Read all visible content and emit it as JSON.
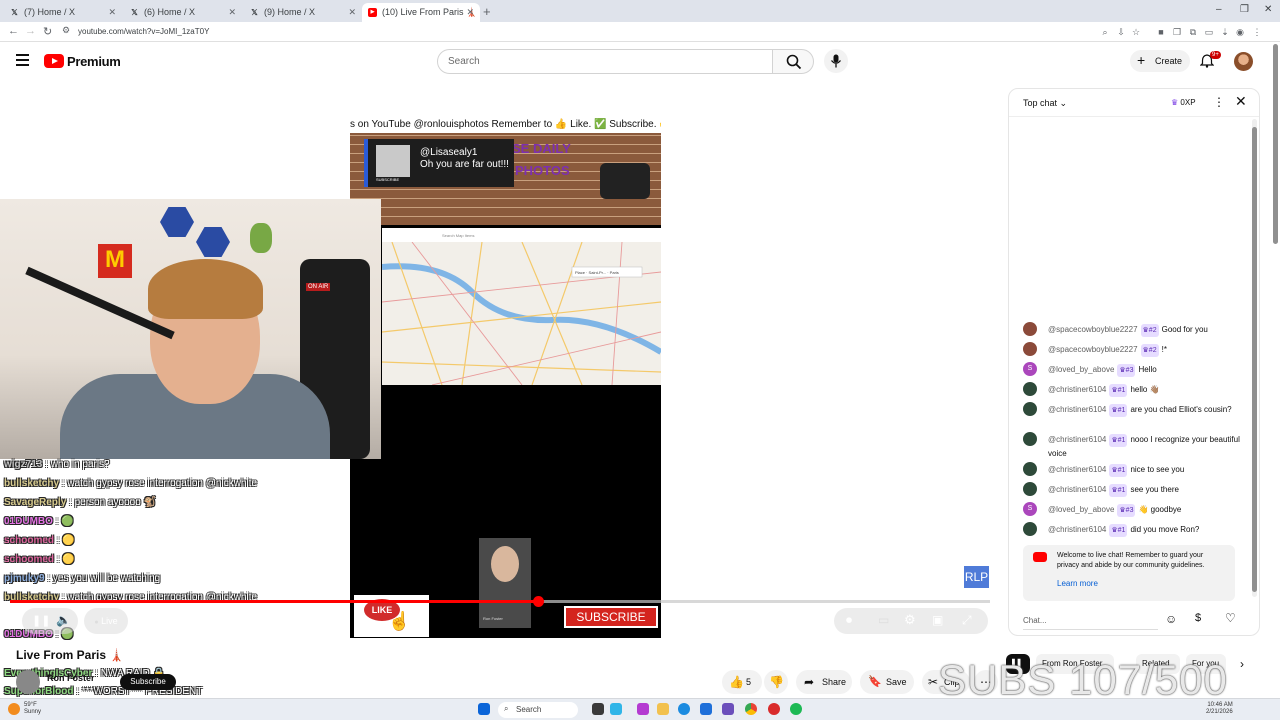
{
  "browser": {
    "tabs": [
      {
        "label": "(7) Home / X",
        "icon": "x-logo-icon",
        "active": false
      },
      {
        "label": "(6) Home / X",
        "icon": "x-logo-icon",
        "active": false
      },
      {
        "label": "(9) Home / X",
        "icon": "x-logo-icon",
        "active": false
      },
      {
        "label": "(10) Live From Paris 🗼 - Yo",
        "icon": "youtube-icon",
        "active": true
      }
    ],
    "new_tab": "+",
    "url": "youtube.com/watch?v=JoMI_1zaT0Y",
    "window_controls": {
      "minimize": "–",
      "restore": "❐",
      "close": "✕"
    }
  },
  "header": {
    "logo_text": "Premium",
    "search_placeholder": "Search",
    "create_label": "Create",
    "notifications_badge": "9+"
  },
  "video": {
    "ticker_text": "s on YouTube @ronlouisphotos Remember to 👍 Like. ✅ Subscribe. 👉Sh",
    "brick_title": "SE DAILY",
    "brick_subtitle": "PHOTOS",
    "popup_name": "@Lisasealy1",
    "popup_message": "Oh you are far out!!!",
    "popup_tag": "SUBSCRIBE",
    "map_search": "Search Map Items",
    "map_places": "Place · Saint-Pr... · Paris",
    "like_text": "LIKE",
    "subscribe_text": "SUBSCRIBE",
    "guest_label": "Ron Foster",
    "live_label": "Live",
    "progress": 0.54,
    "rlp_label": "RLP",
    "subs_overlay": "SUBS 107/500"
  },
  "overlay_chat": [
    {
      "author": "wigz713",
      "message": " : who in paris?",
      "color": "#b9b9b9"
    },
    {
      "author": "bullsketchy",
      "message": " : watch gypsy rose interrogation @nickwhite",
      "color": "#d2c27a"
    },
    {
      "author": "SavageReply",
      "message": " : person ayoooo 🐒",
      "color": "#d2c27a"
    },
    {
      "author": "01DUMBO",
      "message": " : 🟢",
      "color": "#e05ae0"
    },
    {
      "author": "schoomed",
      "message": " : 🟡",
      "color": "#d8478b"
    },
    {
      "author": "schoomed",
      "message": " : 🟡",
      "color": "#d8478b"
    },
    {
      "author": "pjmuky9",
      "message": " : yes you will be watching",
      "color": "#7aa0d8"
    },
    {
      "author": "bullsketchy",
      "message": " : watch gypsy rose interrogation @nickwhite",
      "color": "#d2c27a"
    },
    {
      "author": "01DUMBO",
      "message": " : 🟢",
      "color": "#e05ae0"
    },
    {
      "author": "EverythingIsCyber",
      "message": " : NWA RAID 🔒",
      "color": "#7bd36b"
    },
    {
      "author": "SuperiorBlood",
      "message": " : ***WORST*** PRESIDENT",
      "color": "#7bd36b"
    }
  ],
  "title_area": {
    "title": "Live From Paris 🗼",
    "channel": "Ron Foster",
    "subscribe_label": "Subscribe",
    "likes": "5",
    "share_label": "Share",
    "save_label": "Save",
    "clip_label": "Clip"
  },
  "chat": {
    "mode_label": "Top chat",
    "xp_label": "0XP",
    "messages": [
      {
        "author": "@spacecowboyblue2227",
        "badge": "#2",
        "text": "Good for you",
        "avatar_color": "#8b4a3a"
      },
      {
        "author": "@spacecowboyblue2227",
        "badge": "#2",
        "text": "!*",
        "avatar_color": "#8b4a3a"
      },
      {
        "author": "@loved_by_above",
        "badge": "#3",
        "text": "Hello",
        "avatar_color": "#ab47bc",
        "initial": "S"
      },
      {
        "author": "@christiner6104",
        "badge": "#1",
        "text": "hello 👋🏽",
        "avatar_color": "#2e4a3a"
      },
      {
        "author": "@christiner6104",
        "badge": "#1",
        "text": "are you chad Elliot's cousin?",
        "avatar_color": "#2e4a3a"
      },
      {
        "author": "@christiner6104",
        "badge": "#1",
        "text": "nooo I recognize your beautiful voice",
        "avatar_color": "#2e4a3a"
      },
      {
        "author": "@christiner6104",
        "badge": "#1",
        "text": "nice to see you",
        "avatar_color": "#2e4a3a"
      },
      {
        "author": "@christiner6104",
        "badge": "#1",
        "text": "see you there",
        "avatar_color": "#2e4a3a"
      },
      {
        "author": "@loved_by_above",
        "badge": "#3",
        "text": "👋 goodbye",
        "avatar_color": "#ab47bc",
        "initial": "S"
      },
      {
        "author": "@christiner6104",
        "badge": "#1",
        "text": "did you move Ron?",
        "avatar_color": "#2e4a3a"
      }
    ],
    "welcome_text": "Welcome to live chat! Remember to guard your privacy and abide by our community guidelines.",
    "learn_more": "Learn more",
    "input_placeholder": "Chat..."
  },
  "chips": {
    "from": "From Ron Foster",
    "related": "Related",
    "for_you": "For you"
  },
  "taskbar": {
    "weather_temp": "59°F",
    "weather_desc": "Sunny",
    "search_label": "Search",
    "time": "10:46 AM",
    "date": "2/21/2026"
  },
  "colors": {
    "yt_red": "#ff0000",
    "link_blue": "#065fd4",
    "badge_purple": "#5b2bb5"
  }
}
